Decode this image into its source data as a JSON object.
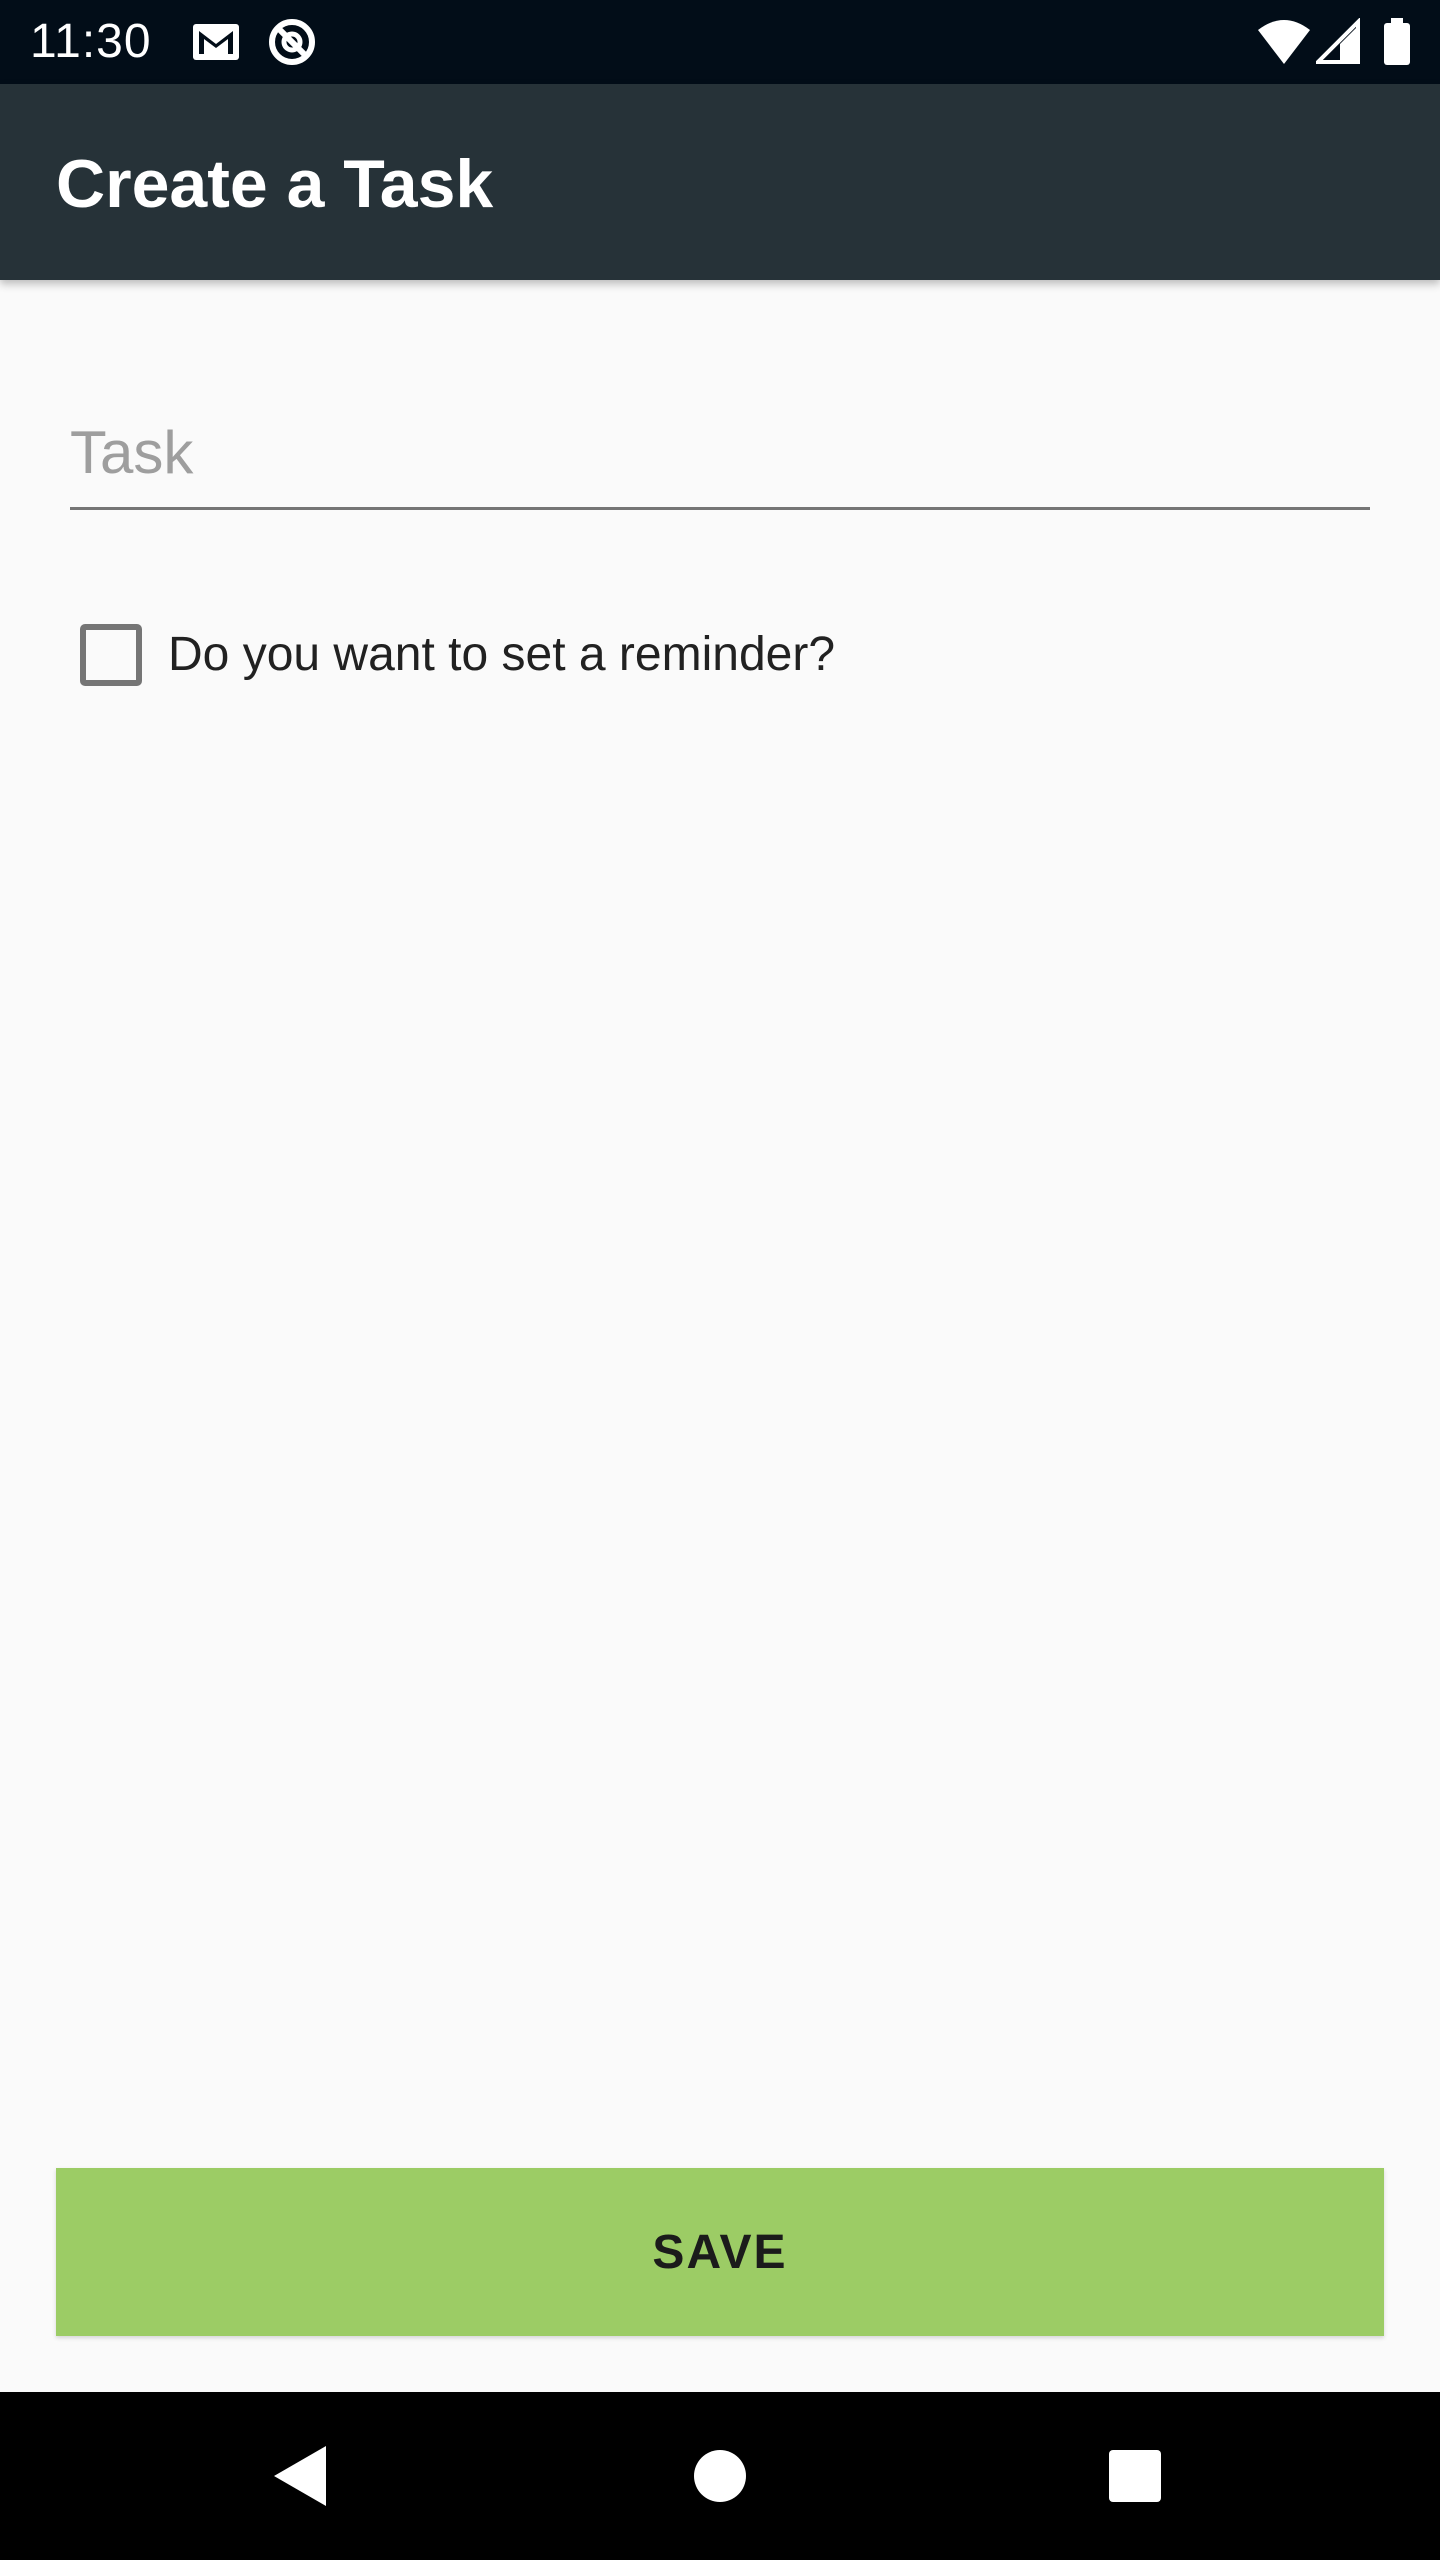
{
  "status_bar": {
    "time": "11:30",
    "left_icons": [
      "gmail-icon",
      "sync-blocked-icon"
    ],
    "right_icons": [
      "wifi-icon",
      "cell-signal-icon",
      "battery-icon"
    ]
  },
  "app_bar": {
    "title": "Create a Task",
    "background_color": "#263238"
  },
  "form": {
    "task_input": {
      "value": "",
      "placeholder": "Task"
    },
    "reminder_checkbox": {
      "label": "Do you want to set a reminder?",
      "checked": false
    },
    "save_button": {
      "label": "SAVE",
      "background_color": "#9ccc65"
    }
  },
  "nav_bar": {
    "buttons": [
      "back-icon",
      "home-icon",
      "recents-icon"
    ]
  }
}
